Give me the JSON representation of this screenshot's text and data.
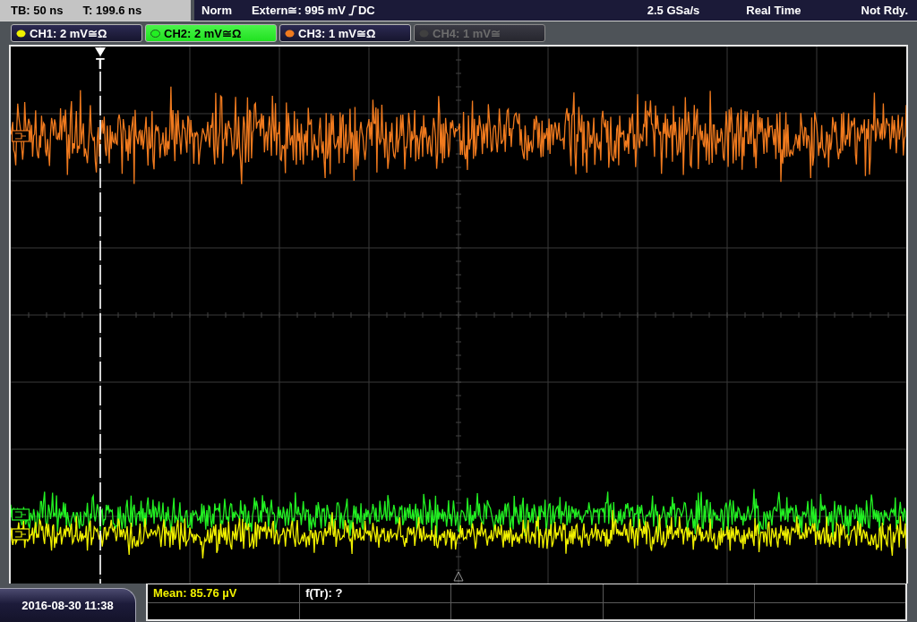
{
  "status_bar": {
    "timebase": "TB: 50 ns",
    "trigger_time": "T: 199.6 ns",
    "trigger_mode": "Norm",
    "trigger_source": "Extern≅: 995 mV",
    "rising_edge": true,
    "trigger_coupling": "DC",
    "sample_rate": "2.5 GSa/s",
    "acquisition_mode": "Real Time",
    "state": "Not Rdy."
  },
  "channels": [
    {
      "label": "CH1: 2 mV≅Ω",
      "color": "#f0f000",
      "selected": false,
      "on": true
    },
    {
      "label": "CH2: 2 mV≅Ω",
      "color": "#22f022",
      "selected": true,
      "on": true
    },
    {
      "label": "CH3: 1 mV≅Ω",
      "color": "#f07a1e",
      "selected": false,
      "on": true
    },
    {
      "label": "CH4: 1 mV≅",
      "color": "#404040",
      "selected": false,
      "on": false
    }
  ],
  "display": {
    "trigger_marker": "T"
  },
  "measurements": [
    {
      "text": "Mean: 85.76 µV",
      "color": "#f0f000"
    },
    {
      "text": "f(Tr): ?",
      "color": "#ffffff"
    }
  ],
  "timestamp": "2016-08-30 11:38"
}
